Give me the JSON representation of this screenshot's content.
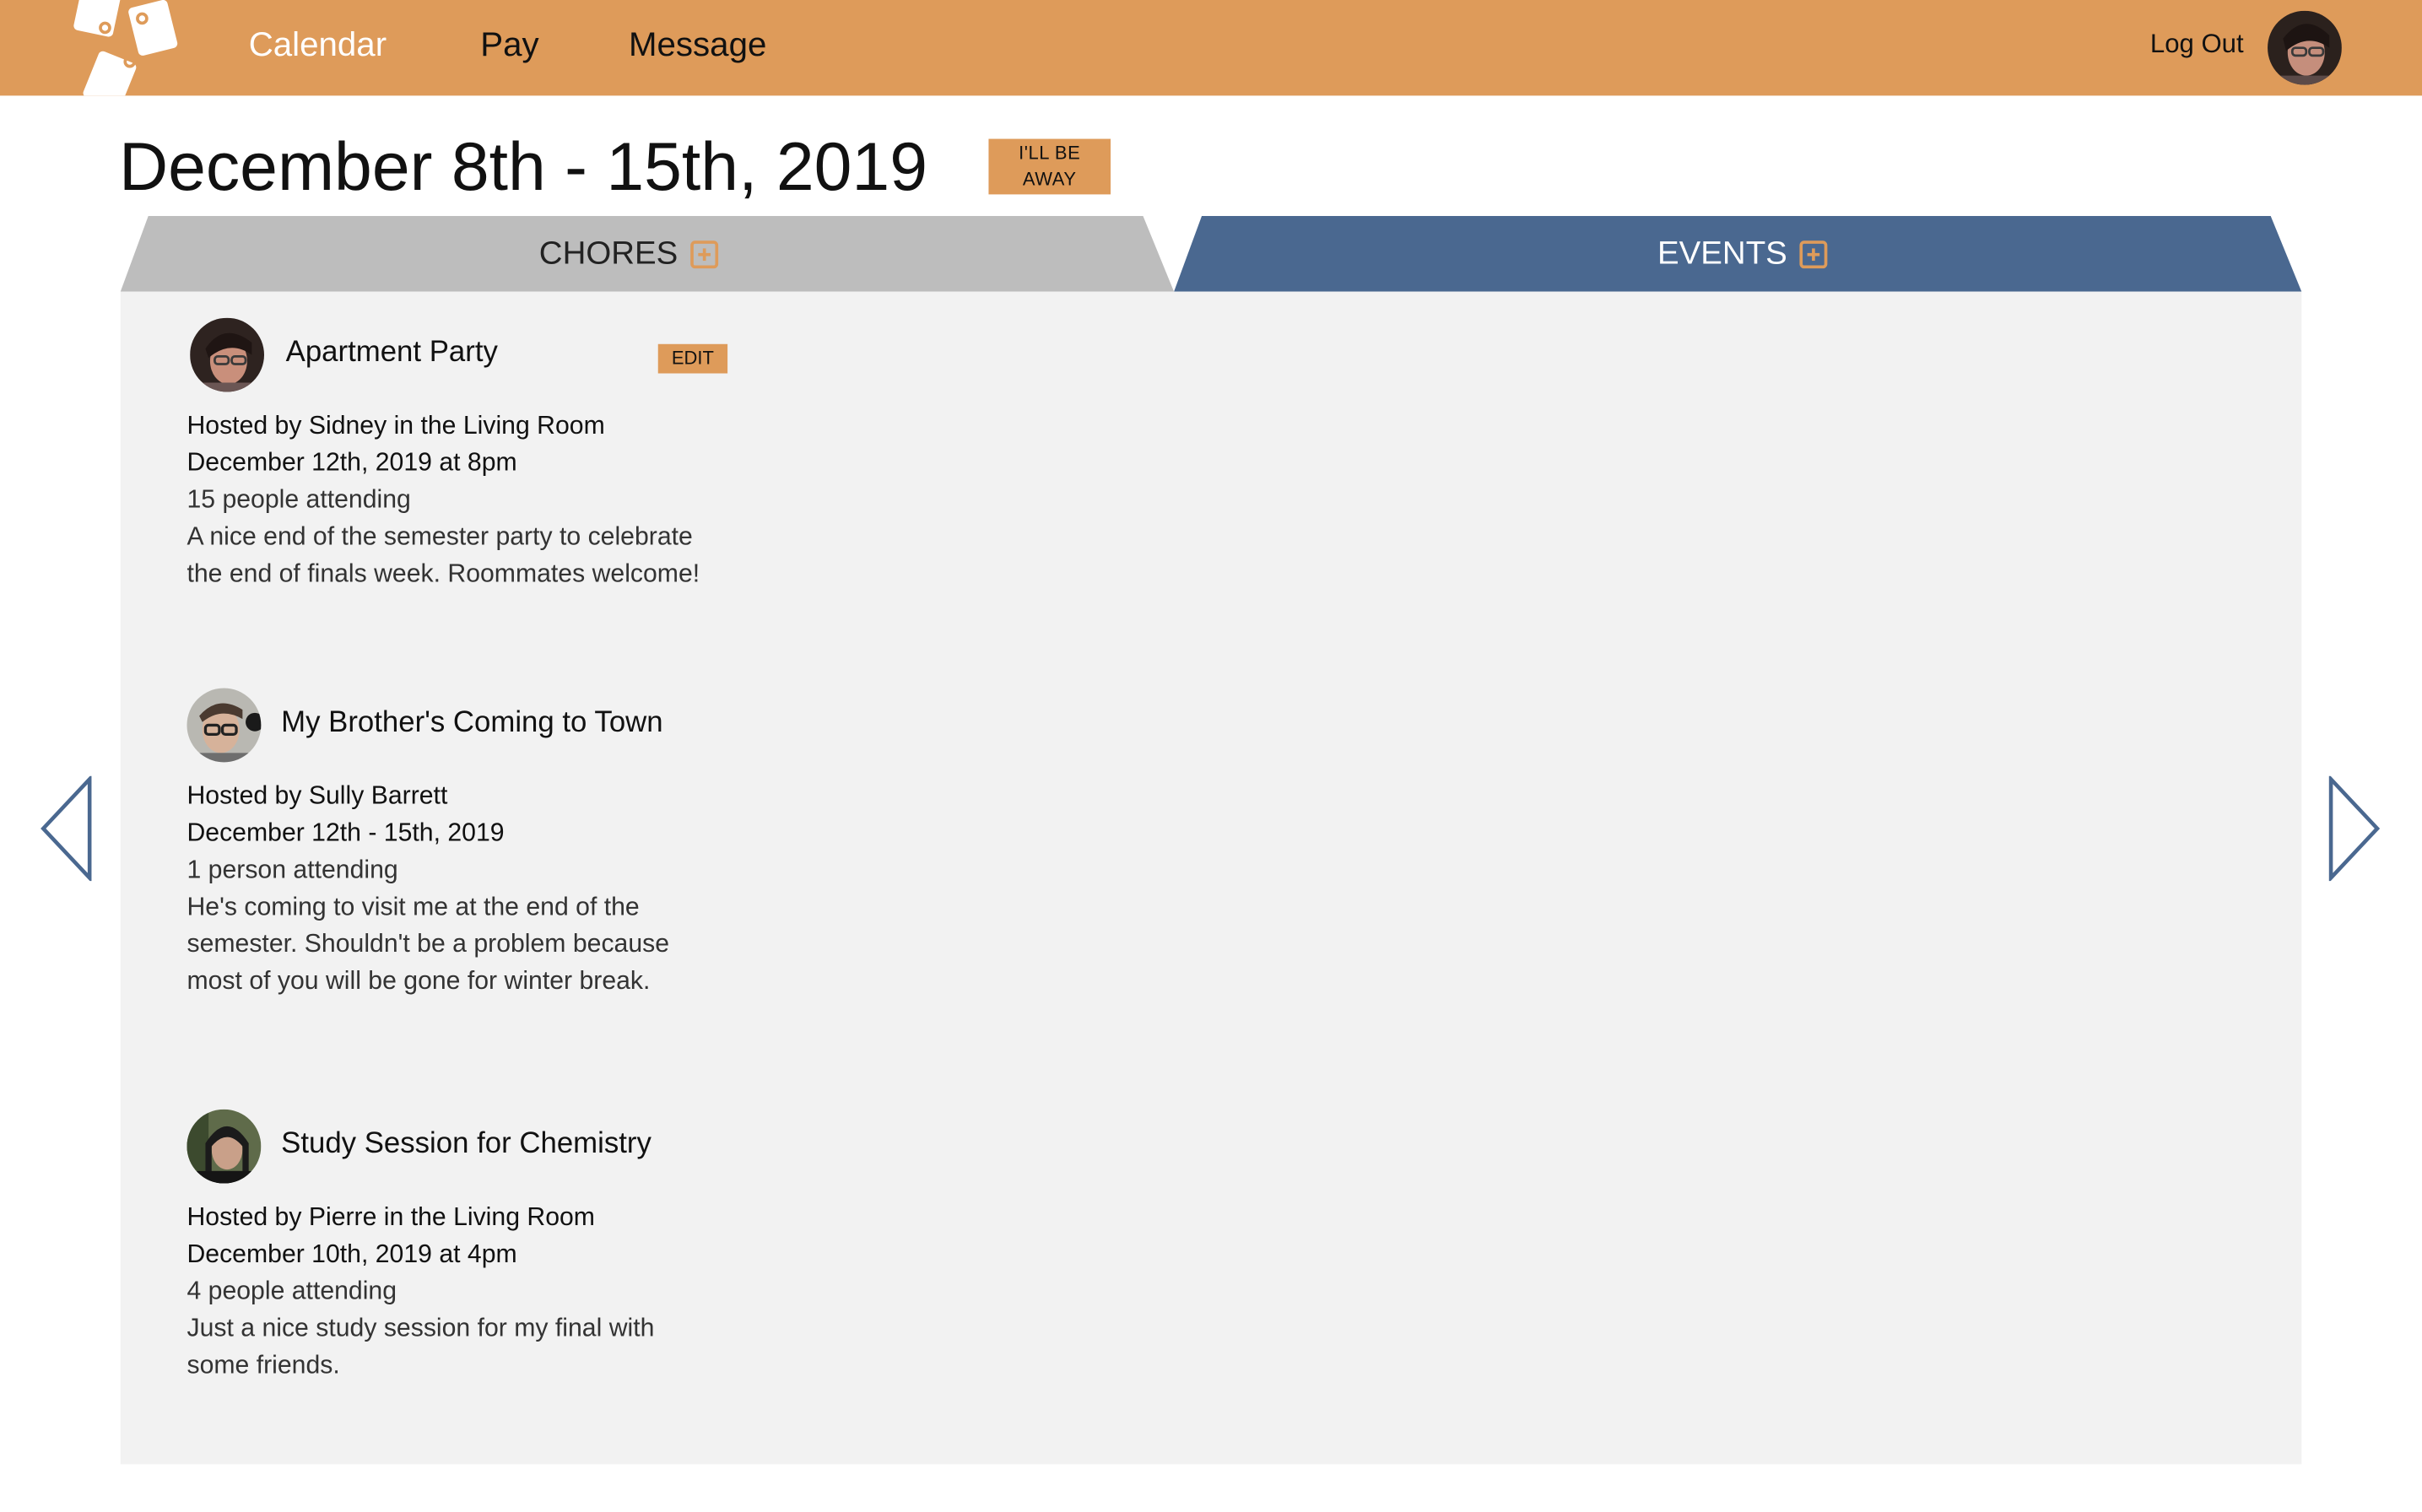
{
  "nav": {
    "items": [
      {
        "label": "Calendar"
      },
      {
        "label": "Pay"
      },
      {
        "label": "Message"
      }
    ],
    "logout_label": "Log Out"
  },
  "header": {
    "week_title": "December 8th - 15th, 2019",
    "away_button_label": "I'LL BE\nAWAY"
  },
  "tabs": [
    {
      "label": "CHORES",
      "icon": "plus-square-icon",
      "active": false
    },
    {
      "label": "EVENTS",
      "icon": "plus-square-icon",
      "active": true
    }
  ],
  "events": [
    {
      "title": "Apartment Party",
      "edit_label": "EDIT",
      "host_line": "Hosted by Sidney in the Living Room",
      "date_line": "December 12th, 2019 at 8pm",
      "attendance": "15 people attending",
      "description": "A nice end of the semester party to celebrate\nthe end of finals week. Roommates welcome!"
    },
    {
      "title": "My Brother's Coming to Town",
      "host_line": "Hosted by Sully Barrett",
      "date_line": "December 12th - 15th, 2019",
      "attendance": "1 person attending",
      "description": "He's coming to visit me at the end of the\nsemester. Shouldn't be a problem because\nmost of you will be gone for winter break."
    },
    {
      "title": "Study Session for Chemistry",
      "host_line": "Hosted by Pierre in the Living Room",
      "date_line": "December 10th, 2019 at 4pm",
      "attendance": "4 people attending",
      "description": "Just a nice study session for my final with\nsome friends."
    }
  ],
  "colors": {
    "brand_orange": "#DE9B5A",
    "events_blue": "#4A6890",
    "chores_gray": "#BDBDBD",
    "panel_gray": "#F2F2F2"
  },
  "icons": {
    "prev": "chevron-left-icon",
    "next": "chevron-right-icon"
  }
}
